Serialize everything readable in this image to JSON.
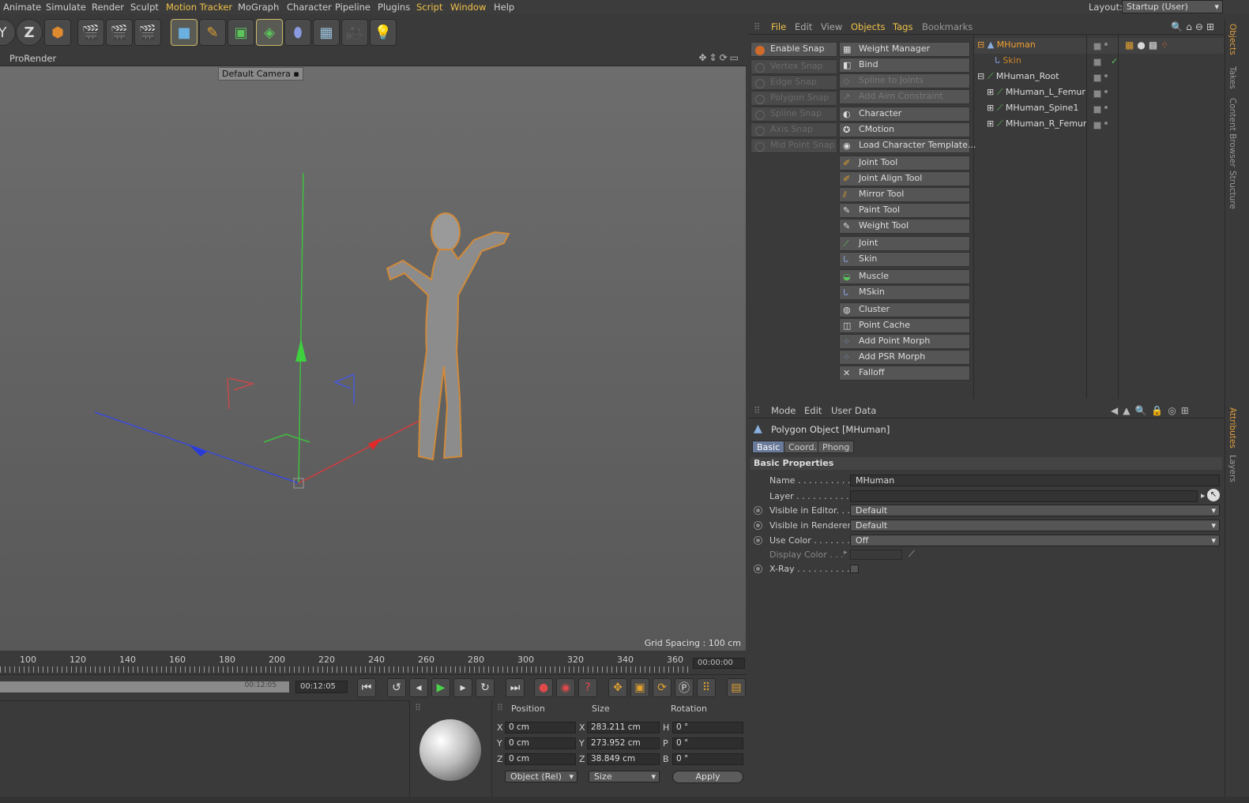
{
  "menubar": {
    "items": [
      "Animate",
      "Simulate",
      "Render",
      "Sculpt",
      "Motion Tracker",
      "MoGraph",
      "Character",
      "Pipeline",
      "Plugins",
      "Script",
      "Window",
      "Help"
    ],
    "highlighted": [
      "Motion Tracker",
      "Script",
      "Window"
    ],
    "layout_label": "Layout:",
    "layout_value": "Startup (User)"
  },
  "toolbar": {
    "buttons": [
      "y-axis-lock-icon",
      "z-axis-lock-icon",
      "coordinate-system-icon",
      "render-view-icon",
      "render-picture-queue-icon",
      "render-settings-icon",
      "cube-icon",
      "pen-icon",
      "subdivision-icon",
      "array-icon",
      "deformer-icon",
      "floor-grid-icon",
      "camera-icon",
      "light-icon"
    ]
  },
  "viewport": {
    "panel_label": "ProRender",
    "camera_label": "Default Camera",
    "grid_spacing": "Grid Spacing : 100 cm"
  },
  "timeline": {
    "ticks": [
      "100",
      "120",
      "140",
      "160",
      "180",
      "200",
      "220",
      "240",
      "260",
      "280",
      "300",
      "320",
      "340",
      "360"
    ],
    "end_time": "00:00:00",
    "slider_time": "00:12:05",
    "current_time": "00:12:05"
  },
  "coordinates": {
    "headers": [
      "Position",
      "Size",
      "Rotation"
    ],
    "rows": [
      {
        "axis": "X",
        "position": "0 cm",
        "size_axis": "X",
        "size": "283.211 cm",
        "rot_axis": "H",
        "rotation": "0 °"
      },
      {
        "axis": "Y",
        "position": "0 cm",
        "size_axis": "Y",
        "size": "273.952 cm",
        "rot_axis": "P",
        "rotation": "0 °"
      },
      {
        "axis": "Z",
        "position": "0 cm",
        "size_axis": "Z",
        "size": "38.849 cm",
        "rot_axis": "B",
        "rotation": "0 °"
      }
    ],
    "mode_dropdown": "Object (Rel)",
    "size_dropdown": "Size",
    "apply": "Apply"
  },
  "object_manager": {
    "menu": [
      "File",
      "Edit",
      "View",
      "Objects",
      "Tags",
      "Bookmarks"
    ],
    "snap": {
      "enable": "Enable Snap",
      "items": [
        "Vertex Snap",
        "Edge Snap",
        "Polygon Snap",
        "Spline Snap",
        "Axis Snap",
        "Mid Point Snap"
      ]
    },
    "character_menu": [
      {
        "group": [
          {
            "label": "Weight Manager",
            "icon": "weight-manager-icon",
            "enabled": true
          },
          {
            "label": "Bind",
            "icon": "bind-icon",
            "enabled": true
          },
          {
            "label": "Spline to Joints",
            "icon": "spline-to-joints-icon",
            "enabled": false
          },
          {
            "label": "Add Aim Constraint",
            "icon": "aim-constraint-icon",
            "enabled": false
          }
        ]
      },
      {
        "group": [
          {
            "label": "Character",
            "icon": "character-icon",
            "enabled": true
          },
          {
            "label": "CMotion",
            "icon": "cmotion-icon",
            "enabled": true
          },
          {
            "label": "Load Character Template...",
            "icon": "template-icon",
            "enabled": true
          }
        ]
      },
      {
        "group": [
          {
            "label": "Joint Tool",
            "icon": "joint-tool-icon",
            "enabled": true
          },
          {
            "label": "Joint Align Tool",
            "icon": "joint-align-icon",
            "enabled": true
          },
          {
            "label": "Mirror Tool",
            "icon": "mirror-tool-icon",
            "enabled": true
          },
          {
            "label": "Paint Tool",
            "icon": "paint-tool-icon",
            "enabled": true
          },
          {
            "label": "Weight Tool",
            "icon": "weight-tool-icon",
            "enabled": true
          }
        ]
      },
      {
        "group": [
          {
            "label": "Joint",
            "icon": "joint-icon",
            "enabled": true
          },
          {
            "label": "Skin",
            "icon": "skin-icon",
            "enabled": true
          }
        ]
      },
      {
        "group": [
          {
            "label": "Muscle",
            "icon": "muscle-icon",
            "enabled": true
          },
          {
            "label": "MSkin",
            "icon": "mskin-icon",
            "enabled": true
          }
        ]
      },
      {
        "group": [
          {
            "label": "Cluster",
            "icon": "cluster-icon",
            "enabled": true
          },
          {
            "label": "Point Cache",
            "icon": "point-cache-icon",
            "enabled": true
          },
          {
            "label": "Add Point Morph",
            "icon": "point-morph-icon",
            "enabled": true
          },
          {
            "label": "Add PSR Morph",
            "icon": "psr-morph-icon",
            "enabled": true
          },
          {
            "label": "Falloff",
            "icon": "falloff-icon",
            "enabled": true
          }
        ]
      }
    ],
    "tree": [
      "MHuman",
      "Skin",
      "MHuman_Root",
      "MHuman_L_Femur",
      "MHuman_Spine1",
      "MHuman_R_Femur"
    ]
  },
  "attributes": {
    "menu": [
      "Mode",
      "Edit",
      "User Data"
    ],
    "object_title": "Polygon Object [MHuman]",
    "tabs": [
      "Basic",
      "Coord.",
      "Phong"
    ],
    "section": "Basic Properties",
    "props": {
      "name_label": "Name . . . . . . . . . . . .",
      "name_value": "MHuman",
      "layer_label": "Layer . . . . . . . . . . . .",
      "vis_editor_label": "Visible in Editor. . .",
      "vis_editor_value": "Default",
      "vis_render_label": "Visible in Renderer",
      "vis_render_value": "Default",
      "use_color_label": "Use Color . . . . . . . .",
      "use_color_value": "Off",
      "display_color_label": "Display Color . . .",
      "xray_label": "X-Ray . . . . . . . . . . ."
    }
  },
  "side_tabs": [
    "Objects",
    "Takes",
    "Content Browser",
    "Structure",
    "Attributes",
    "Layers"
  ],
  "colors": {
    "accent": "#f0c24a",
    "selected": "#f0a030"
  }
}
